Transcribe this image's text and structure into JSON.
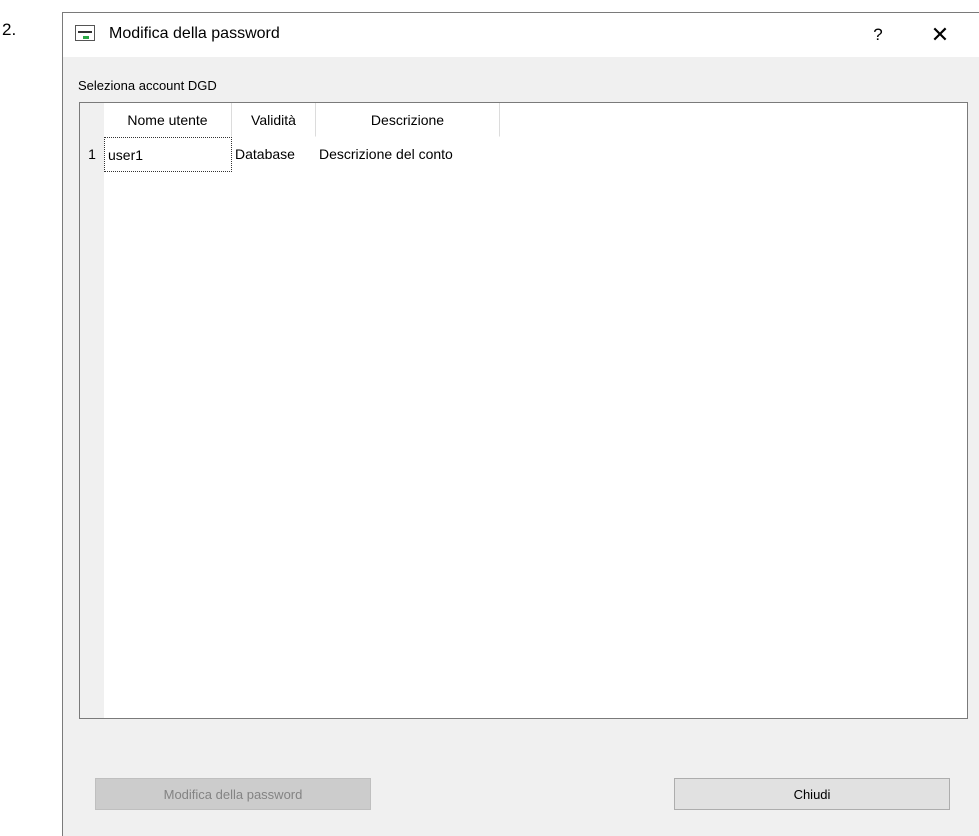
{
  "step": {
    "number": "2."
  },
  "dialog": {
    "title": "Modifica della password",
    "help_label": "?",
    "close_label": "✕"
  },
  "group": {
    "label": "Seleziona account DGD"
  },
  "table": {
    "columns": [
      "Nome utente",
      "Validità",
      "Descrizione"
    ],
    "rows": [
      {
        "index": "1",
        "username": "user1",
        "validity": "Database",
        "description": "Descrizione del conto"
      }
    ]
  },
  "buttons": {
    "change_password": "Modifica della password",
    "close": "Chiudi"
  }
}
